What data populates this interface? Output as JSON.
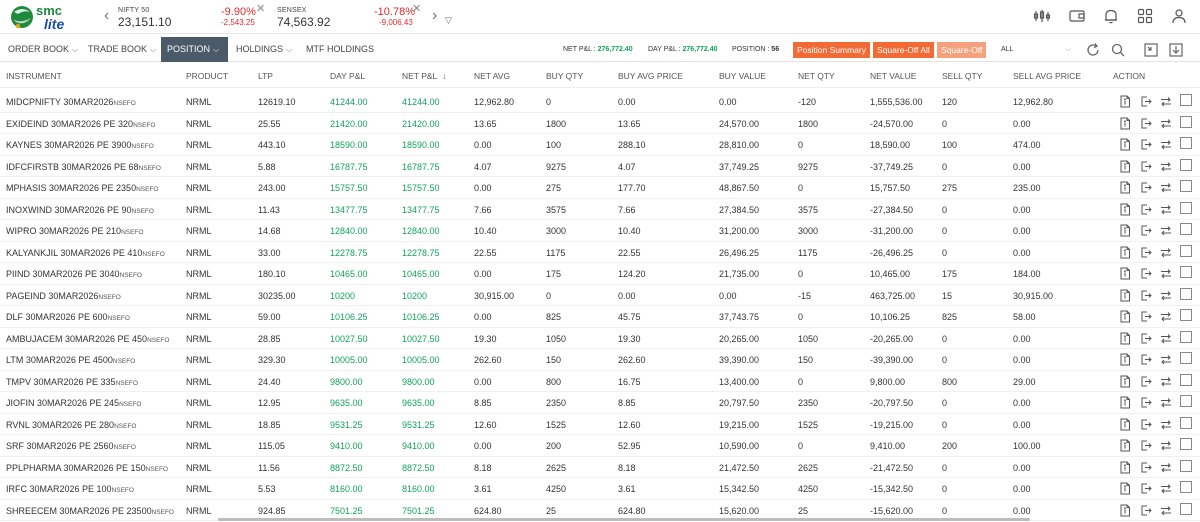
{
  "brand": {
    "logo_text_top": "smc",
    "logo_text_bottom": "lite"
  },
  "indices": [
    {
      "name": "NIFTY 50",
      "value": "23,151.10",
      "change_pct": "-9.90%",
      "change": "-2,543.25"
    },
    {
      "name": "SENSEX",
      "value": "74,563.92",
      "change_pct": "-10.78%",
      "change": "-9,006.43"
    }
  ],
  "tabs": [
    {
      "label": "ORDER BOOK",
      "has_dropdown": true,
      "active": false
    },
    {
      "label": "TRADE BOOK",
      "has_dropdown": true,
      "active": false
    },
    {
      "label": "POSITION",
      "has_dropdown": true,
      "active": true
    },
    {
      "label": "HOLDINGS",
      "has_dropdown": true,
      "active": false
    },
    {
      "label": "MTF HOLDINGS",
      "has_dropdown": false,
      "active": false
    }
  ],
  "summary": {
    "net_pnl_label": "NET P&L :",
    "net_pnl_value": "276,772.40",
    "day_pnl_label": "DAY P&L :",
    "day_pnl_value": "276,772.40",
    "position_label": "POSITION :",
    "position_value": "56"
  },
  "buttons": {
    "position_summary": "Position Summary",
    "square_off_all": "Square-Off All",
    "square_off": "Square-Off"
  },
  "filter": {
    "selected": "ALL"
  },
  "colors": {
    "accent": "#f26b36",
    "active_tab": "#4a5a68",
    "profit": "#12a35a",
    "loss": "#e02b2b"
  },
  "columns": [
    "INSTRUMENT",
    "PRODUCT",
    "LTP",
    "DAY P&L",
    "NET P&L",
    "NET AVG",
    "BUY QTY",
    "BUY AVG PRICE",
    "BUY VALUE",
    "NET QTY",
    "NET VALUE",
    "SELL QTY",
    "SELL AVG PRICE",
    "ACTION"
  ],
  "sort_indicator": "↓",
  "rows": [
    [
      "MIDCPNIFTY 30MAR2026",
      "NSEFO",
      "NRML",
      "12619.10",
      "41244.00",
      "41244.00",
      "12,962.80",
      "0",
      "0.00",
      "0.00",
      "-120",
      "1,555,536.00",
      "120",
      "12,962.80"
    ],
    [
      "EXIDEIND 30MAR2026 PE 320",
      "NSEFO",
      "NRML",
      "25.55",
      "21420.00",
      "21420.00",
      "13.65",
      "1800",
      "13.65",
      "24,570.00",
      "1800",
      "-24,570.00",
      "0",
      "0.00"
    ],
    [
      "KAYNES 30MAR2026 PE 3900",
      "NSEFO",
      "NRML",
      "443.10",
      "18590.00",
      "18590.00",
      "0.00",
      "100",
      "288.10",
      "28,810.00",
      "0",
      "18,590.00",
      "100",
      "474.00"
    ],
    [
      "IDFCFIRSTB 30MAR2026 PE 68",
      "NSEFO",
      "NRML",
      "5.88",
      "16787.75",
      "16787.75",
      "4.07",
      "9275",
      "4.07",
      "37,749.25",
      "9275",
      "-37,749.25",
      "0",
      "0.00"
    ],
    [
      "MPHASIS 30MAR2026 PE 2350",
      "NSEFO",
      "NRML",
      "243.00",
      "15757.50",
      "15757.50",
      "0.00",
      "275",
      "177.70",
      "48,867.50",
      "0",
      "15,757.50",
      "275",
      "235.00"
    ],
    [
      "INOXWIND 30MAR2026 PE 90",
      "NSEFO",
      "NRML",
      "11.43",
      "13477.75",
      "13477.75",
      "7.66",
      "3575",
      "7.66",
      "27,384.50",
      "3575",
      "-27,384.50",
      "0",
      "0.00"
    ],
    [
      "WIPRO 30MAR2026 PE 210",
      "NSEFO",
      "NRML",
      "14.68",
      "12840.00",
      "12840.00",
      "10.40",
      "3000",
      "10.40",
      "31,200.00",
      "3000",
      "-31,200.00",
      "0",
      "0.00"
    ],
    [
      "KALYANKJIL 30MAR2026 PE 410",
      "NSEFO",
      "NRML",
      "33.00",
      "12278.75",
      "12278.75",
      "22.55",
      "1175",
      "22.55",
      "26,496.25",
      "1175",
      "-26,496.25",
      "0",
      "0.00"
    ],
    [
      "PIIND 30MAR2026 PE 3040",
      "NSEFO",
      "NRML",
      "180.10",
      "10465.00",
      "10465.00",
      "0.00",
      "175",
      "124.20",
      "21,735.00",
      "0",
      "10,465.00",
      "175",
      "184.00"
    ],
    [
      "PAGEIND 30MAR2026",
      "NSEFO",
      "NRML",
      "30235.00",
      "10200",
      "10200",
      "30,915.00",
      "0",
      "0.00",
      "0.00",
      "-15",
      "463,725.00",
      "15",
      "30,915.00"
    ],
    [
      "DLF 30MAR2026 PE 600",
      "NSEFO",
      "NRML",
      "59.00",
      "10106.25",
      "10106.25",
      "0.00",
      "825",
      "45.75",
      "37,743.75",
      "0",
      "10,106.25",
      "825",
      "58.00"
    ],
    [
      "AMBUJACEM 30MAR2026 PE 450",
      "NSEFO",
      "NRML",
      "28.85",
      "10027.50",
      "10027.50",
      "19.30",
      "1050",
      "19.30",
      "20,265.00",
      "1050",
      "-20,265.00",
      "0",
      "0.00"
    ],
    [
      "LTM 30MAR2026 PE 4500",
      "NSEFO",
      "NRML",
      "329.30",
      "10005.00",
      "10005.00",
      "262.60",
      "150",
      "262.60",
      "39,390.00",
      "150",
      "-39,390.00",
      "0",
      "0.00"
    ],
    [
      "TMPV 30MAR2026 PE 335",
      "NSEFO",
      "NRML",
      "24.40",
      "9800.00",
      "9800.00",
      "0.00",
      "800",
      "16.75",
      "13,400.00",
      "0",
      "9,800.00",
      "800",
      "29.00"
    ],
    [
      "JIOFIN 30MAR2026 PE 245",
      "NSEFO",
      "NRML",
      "12.95",
      "9635.00",
      "9635.00",
      "8.85",
      "2350",
      "8.85",
      "20,797.50",
      "2350",
      "-20,797.50",
      "0",
      "0.00"
    ],
    [
      "RVNL 30MAR2026 PE 280",
      "NSEFO",
      "NRML",
      "18.85",
      "9531.25",
      "9531.25",
      "12.60",
      "1525",
      "12.60",
      "19,215.00",
      "1525",
      "-19,215.00",
      "0",
      "0.00"
    ],
    [
      "SRF 30MAR2026 PE 2560",
      "NSEFO",
      "NRML",
      "115.05",
      "9410.00",
      "9410.00",
      "0.00",
      "200",
      "52.95",
      "10,590.00",
      "0",
      "9,410.00",
      "200",
      "100.00"
    ],
    [
      "PPLPHARMA 30MAR2026 PE 150",
      "NSEFO",
      "NRML",
      "11.56",
      "8872.50",
      "8872.50",
      "8.18",
      "2625",
      "8.18",
      "21,472.50",
      "2625",
      "-21,472.50",
      "0",
      "0.00"
    ],
    [
      "IRFC 30MAR2026 PE 100",
      "NSEFO",
      "NRML",
      "5.53",
      "8160.00",
      "8160.00",
      "3.61",
      "4250",
      "3.61",
      "15,342.50",
      "4250",
      "-15,342.50",
      "0",
      "0.00"
    ],
    [
      "SHREECEM 30MAR2026 PE 23500",
      "NSEFO",
      "NRML",
      "924.85",
      "7501.25",
      "7501.25",
      "624.80",
      "25",
      "624.80",
      "15,620.00",
      "25",
      "-15,620.00",
      "0",
      "0.00"
    ]
  ]
}
